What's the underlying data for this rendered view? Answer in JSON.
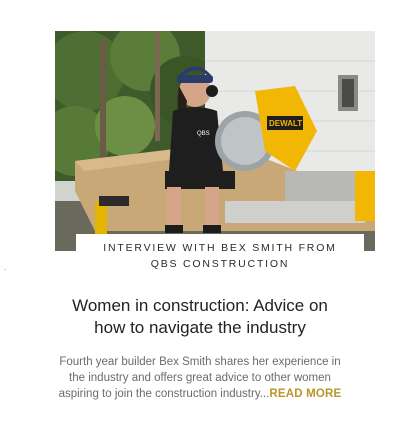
{
  "article": {
    "image_alt": "Woman in cap and ear protection sitting beside a yellow DeWalt mitre saw on a workbench outdoors",
    "category_line1": "INTERVIEW WITH BEX SMITH FROM",
    "category_line2": "QBS CONSTRUCTION",
    "title_line1": "Women in construction: Advice on",
    "title_line2": "how to navigate the industry",
    "excerpt_line1": "Fourth year builder Bex Smith shares her experience in",
    "excerpt_line2": "the industry and offers great advice to other women",
    "excerpt_line3": "aspiring to join the construction industry...",
    "read_more_label": "READ MORE",
    "saw_brand": "DEWALT",
    "shirt_text": "QBS"
  },
  "colors": {
    "read_more": "#b9962c",
    "title": "#222222",
    "body_text": "#6b6b6b",
    "saw_yellow": "#f2b705"
  }
}
